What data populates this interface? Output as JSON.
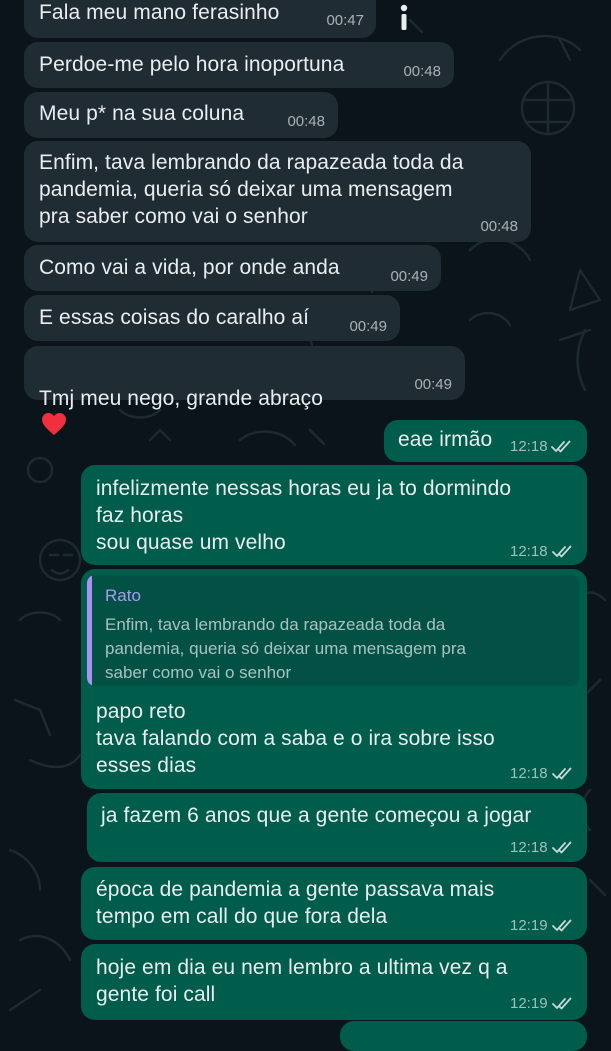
{
  "chat": {
    "messages": [
      {
        "text": "Fala meu mano ferasinho",
        "time": "00:47"
      },
      {
        "text": "Perdoe-me pelo hora inoportuna",
        "time": "00:48"
      },
      {
        "text": "Meu p* na sua coluna",
        "time": "00:48"
      },
      {
        "text": "Enfim, tava lembrando da rapazeada toda da\npandemia, queria só deixar uma mensagem\npra saber como vai o senhor",
        "time": "00:48"
      },
      {
        "text": "Como vai a vida, por onde anda",
        "time": "00:49"
      },
      {
        "text": "E essas coisas do caralho aí",
        "time": "00:49"
      },
      {
        "text": "Tmj meu nego, grande abraço",
        "emoji": "red-heart",
        "time": "00:49"
      },
      {
        "text": "eae irmão",
        "time": "12:18"
      },
      {
        "text": "infelizmente nessas horas eu ja to dormindo\nfaz horas\nsou quase um velho",
        "time": "12:18"
      },
      {
        "text": "papo reto\ntava falando com a saba e o ira sobre isso\nesses dias",
        "time": "12:18",
        "reply": {
          "author": "Rato",
          "text": "Enfim, tava lembrando da rapazeada toda da\npandemia, queria só deixar uma mensagem pra\nsaber como vai o senhor"
        }
      },
      {
        "text": "ja fazem 6 anos que a gente começou a jogar",
        "time": "12:18"
      },
      {
        "text": "época de pandemia a gente passava mais\ntempo em call do que fora dela",
        "time": "12:19"
      },
      {
        "text": "hoje em dia eu nem lembro a ultima vez q a\ngente foi call",
        "time": "12:19"
      }
    ]
  },
  "colors": {
    "background": "#0b141a",
    "incoming_bubble": "#202c33",
    "outgoing_bubble": "#005c4b",
    "read_ticks": "#e9edef",
    "reply_author": "#a99bf3"
  },
  "icons": {
    "read_receipt": "double-check-icon",
    "info": "info-icon",
    "emoji": "red-heart-emoji"
  }
}
